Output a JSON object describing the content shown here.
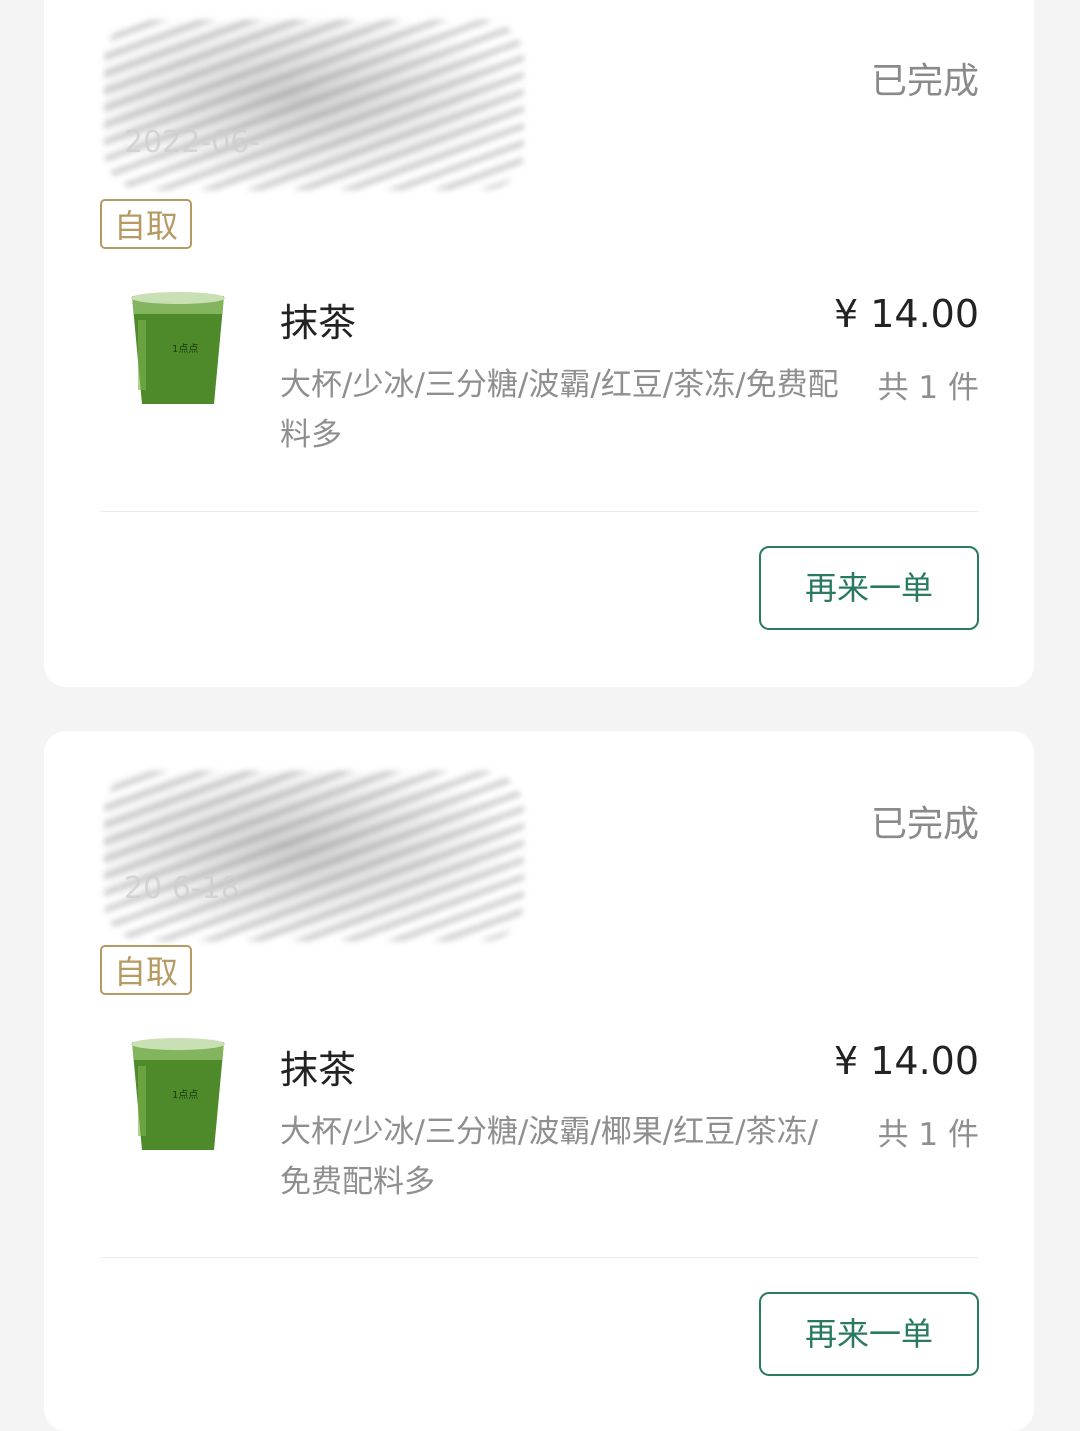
{
  "orders": [
    {
      "status": "已完成",
      "date_text": "2022-06-",
      "badge": "自取",
      "item": {
        "name": "抹茶",
        "price": "¥ 14.00",
        "options": "大杯/少冰/三分糖/波霸/红豆/茶冻/免费配料多",
        "quantity": "共 1 件",
        "image": "matcha-cup-icon"
      },
      "reorder_label": "再来一单"
    },
    {
      "status": "已完成",
      "date_text": "20  6-18",
      "badge": "自取",
      "item": {
        "name": "抹茶",
        "price": "¥ 14.00",
        "options": "大杯/少冰/三分糖/波霸/椰果/红豆/茶冻/免费配料多",
        "quantity": "共 1 件",
        "image": "matcha-cup-icon"
      },
      "reorder_label": "再来一单"
    }
  ],
  "colors": {
    "background": "#f4f4f4",
    "card": "#ffffff",
    "accent_green": "#2a7a62",
    "badge_gold": "#b69a61",
    "muted_text": "#8f8f8f",
    "cup_green": "#4f8a2a"
  }
}
